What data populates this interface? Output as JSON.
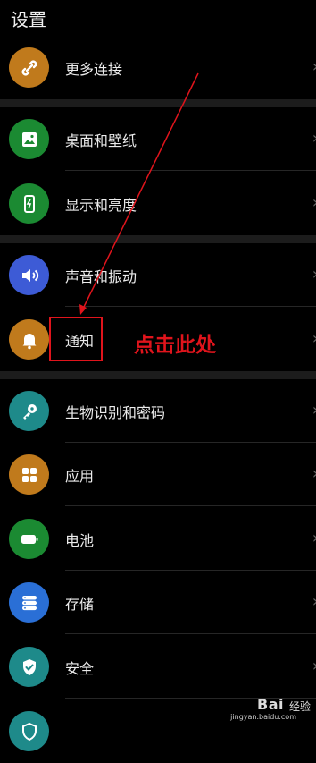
{
  "header": {
    "title": "设置"
  },
  "rows": [
    {
      "label": "更多连接",
      "icon": "link-icon",
      "color": "#c07a1c"
    },
    {
      "label": "桌面和壁纸",
      "icon": "image-icon",
      "color": "#1b8a32"
    },
    {
      "label": "显示和亮度",
      "icon": "phone-brightness-icon",
      "color": "#1b8a32"
    },
    {
      "label": "声音和振动",
      "icon": "speaker-icon",
      "color": "#3d5bd6"
    },
    {
      "label": "通知",
      "icon": "bell-icon",
      "color": "#c07a1c"
    },
    {
      "label": "生物识别和密码",
      "icon": "key-icon",
      "color": "#1e8a8a"
    },
    {
      "label": "应用",
      "icon": "apps-grid-icon",
      "color": "#c07a1c"
    },
    {
      "label": "电池",
      "icon": "battery-icon",
      "color": "#1b8a32"
    },
    {
      "label": "存储",
      "icon": "storage-icon",
      "color": "#2a6fd6"
    },
    {
      "label": "安全",
      "icon": "shield-check-icon",
      "color": "#1e8a8a"
    },
    {
      "label": "",
      "icon": "shield-icon",
      "color": "#1e8a8a"
    }
  ],
  "chevron": "›",
  "annotation": {
    "text": "点击此处",
    "color": "#e0141c"
  },
  "watermark": {
    "brand": "Bai",
    "brand_suffix": "经验",
    "url": "jingyan.baidu.com"
  }
}
